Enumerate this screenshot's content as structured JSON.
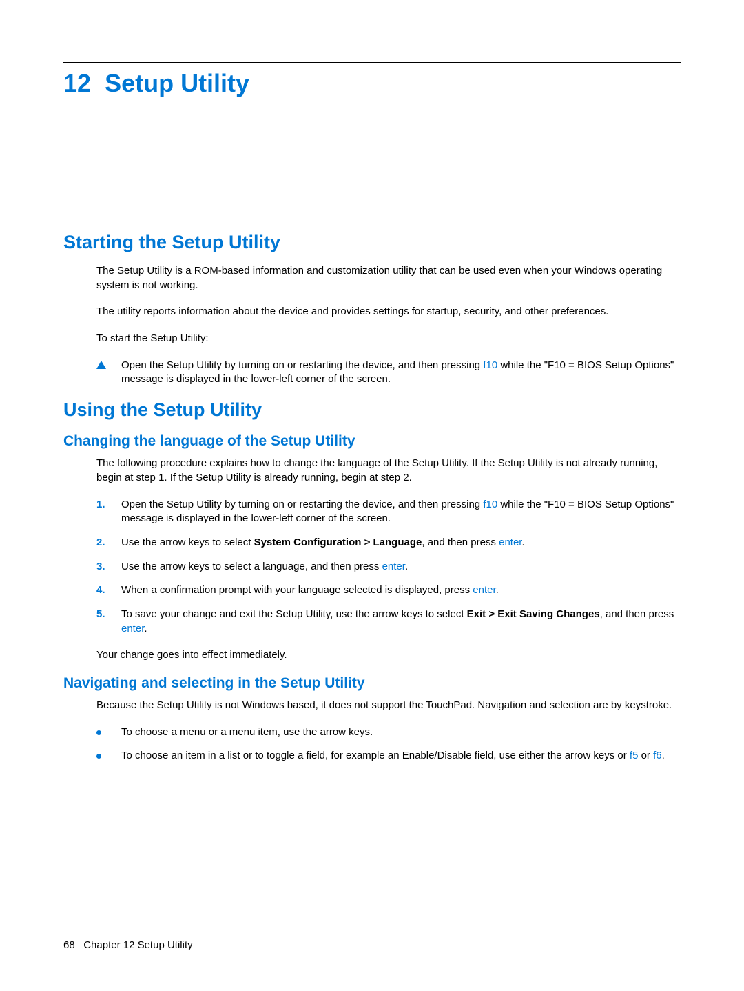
{
  "chapter": {
    "number": "12",
    "title": "Setup Utility"
  },
  "sections": {
    "starting": {
      "heading": "Starting the Setup Utility",
      "p1": "The Setup Utility is a ROM-based information and customization utility that can be used even when your Windows operating system is not working.",
      "p2": "The utility reports information about the device and provides settings for startup, security, and other preferences.",
      "p3": "To start the Setup Utility:",
      "step_pre": "Open the Setup Utility by turning on or restarting the device, and then pressing ",
      "step_key": "f10",
      "step_post": " while the \"F10 = BIOS Setup Options\" message is displayed in the lower-left corner of the screen."
    },
    "using": {
      "heading": "Using the Setup Utility",
      "lang": {
        "heading": "Changing the language of the Setup Utility",
        "intro": "The following procedure explains how to change the language of the Setup Utility. If the Setup Utility is not already running, begin at step 1. If the Setup Utility is already running, begin at step 2.",
        "s1_pre": "Open the Setup Utility by turning on or restarting the device, and then pressing ",
        "s1_key": "f10",
        "s1_post": " while the \"F10 = BIOS Setup Options\" message is displayed in the lower-left corner of the screen.",
        "s2_pre": "Use the arrow keys to select ",
        "s2_bold": "System Configuration > Language",
        "s2_mid": ", and then press ",
        "s2_key": "enter",
        "s2_post": ".",
        "s3_pre": "Use the arrow keys to select a language, and then press ",
        "s3_key": "enter",
        "s3_post": ".",
        "s4_pre": "When a confirmation prompt with your language selected is displayed, press ",
        "s4_key": "enter",
        "s4_post": ".",
        "s5_pre": "To save your change and exit the Setup Utility, use the arrow keys to select ",
        "s5_bold": "Exit > Exit Saving Changes",
        "s5_mid": ", and then press ",
        "s5_key": "enter",
        "s5_post": ".",
        "outro": "Your change goes into effect immediately."
      },
      "nav": {
        "heading": "Navigating and selecting in the Setup Utility",
        "intro": "Because the Setup Utility is not Windows based, it does not support the TouchPad. Navigation and selection are by keystroke.",
        "b1": "To choose a menu or a menu item, use the arrow keys.",
        "b2_pre": "To choose an item in a list or to toggle a field, for example an Enable/Disable field, use either the arrow keys or ",
        "b2_k1": "f5",
        "b2_or": " or ",
        "b2_k2": "f6",
        "b2_post": "."
      }
    }
  },
  "footer": {
    "page": "68",
    "label": "Chapter 12   Setup Utility"
  }
}
